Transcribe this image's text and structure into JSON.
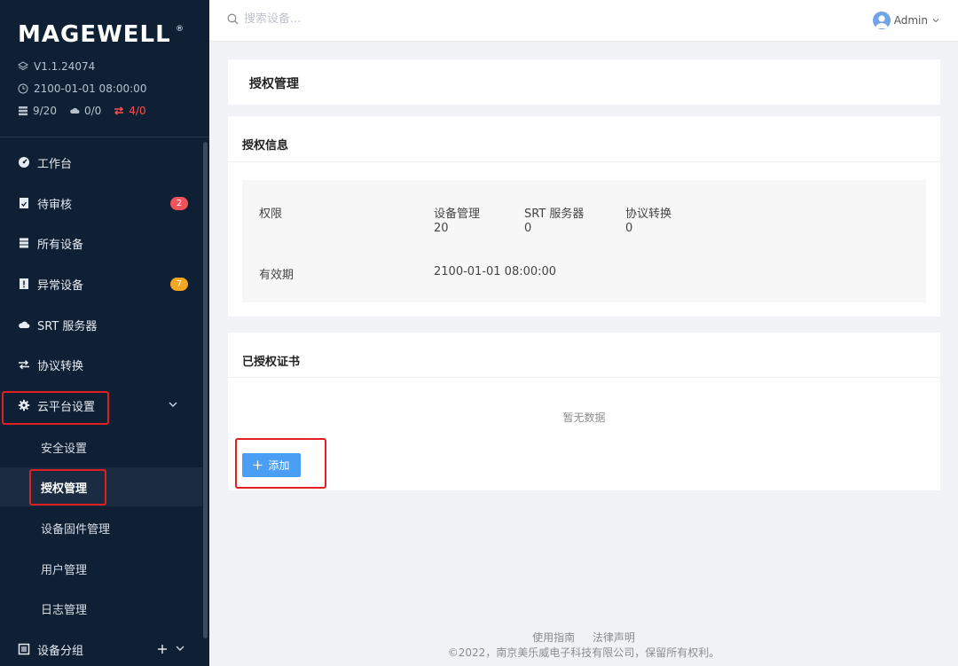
{
  "app": {
    "brand": "MAGEWELL",
    "brand_mark": "®",
    "version": "V1.1.24074",
    "datetime": "2100-01-01 08:00:00",
    "stats": {
      "devices": "9/20",
      "cloud": "0/0",
      "transcode": "4/0"
    }
  },
  "sidebar": {
    "items": [
      {
        "label": "工作台",
        "icon": "dashboard-icon"
      },
      {
        "label": "待审核",
        "icon": "pending-review-icon",
        "badge": "2"
      },
      {
        "label": "所有设备",
        "icon": "device-list-icon"
      },
      {
        "label": "异常设备",
        "icon": "abnormal-device-icon",
        "badge": "7"
      },
      {
        "label": "SRT 服务器",
        "icon": "cloud-icon"
      },
      {
        "label": "协议转换",
        "icon": "protocol-convert-icon"
      },
      {
        "label": "云平台设置",
        "icon": "gear-icon"
      }
    ],
    "subitems": [
      {
        "label": "安全设置"
      },
      {
        "label": "授权管理"
      },
      {
        "label": "设备固件管理"
      },
      {
        "label": "用户管理"
      },
      {
        "label": "日志管理"
      }
    ],
    "group": {
      "label": "设备分组",
      "icon": "device-group-icon"
    }
  },
  "topbar": {
    "search_placeholder": "搜索设备...",
    "user": "Admin"
  },
  "page": {
    "title": "授权管理",
    "license_info_title": "授权信息",
    "permission_label": "权限",
    "columns": [
      {
        "name": "设备管理",
        "value": "20"
      },
      {
        "name": "SRT 服务器",
        "value": "0"
      },
      {
        "name": "协议转换",
        "value": "0"
      }
    ],
    "validity_label": "有效期",
    "validity_value": "2100-01-01 08:00:00",
    "certs_title": "已授权证书",
    "empty_text": "暂无数据",
    "add_button": "添加"
  },
  "footer": {
    "guide": "使用指南",
    "legal": "法律声明",
    "copyright": "©2022，南京美乐威电子科技有限公司，保留所有权利。"
  },
  "colors": {
    "sidebar_bg": "#0f2035",
    "accent": "#4a9ff5",
    "alert": "#ff4d4f",
    "highlight_box": "#e02020"
  }
}
